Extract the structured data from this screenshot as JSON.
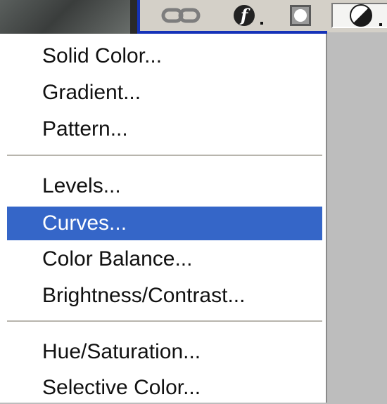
{
  "toolbar": {
    "icons": [
      "link-layers-icon",
      "layer-style-icon",
      "layer-mask-icon",
      "adjustment-layer-icon"
    ]
  },
  "menu": {
    "items": [
      {
        "label": "Solid Color..."
      },
      {
        "label": "Gradient..."
      },
      {
        "label": "Pattern..."
      },
      {
        "label": "Levels..."
      },
      {
        "label": "Curves...",
        "highlighted": true
      },
      {
        "label": "Color Balance..."
      },
      {
        "label": "Brightness/Contrast..."
      },
      {
        "label": "Hue/Saturation..."
      },
      {
        "label": "Selective Color..."
      }
    ]
  },
  "colors": {
    "highlight": "#3566c8",
    "toolbar_border": "#1532b8",
    "menu_bg": "#ffffff",
    "toolbar_bg": "#d4d0c8"
  }
}
